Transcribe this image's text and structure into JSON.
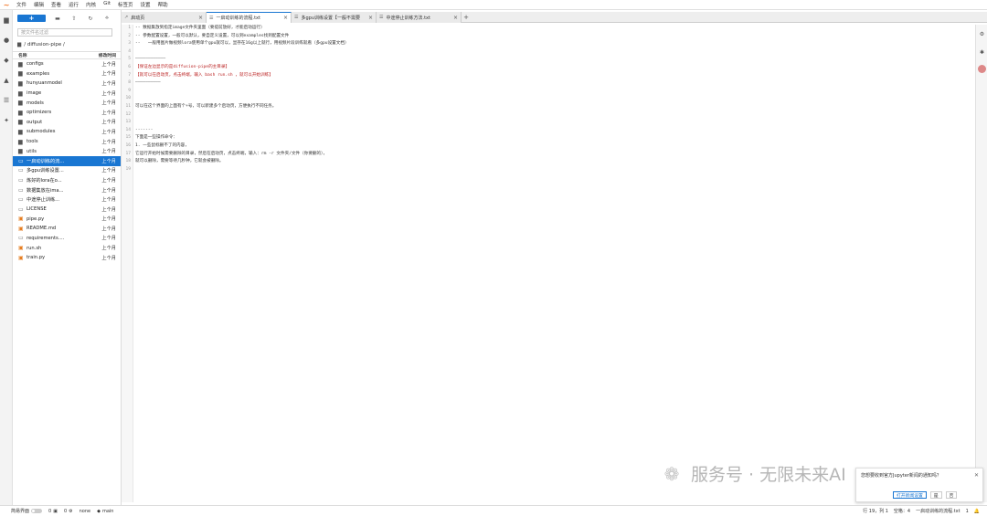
{
  "menu": [
    "文件",
    "编辑",
    "查看",
    "运行",
    "内核",
    "Git",
    "标签页",
    "设置",
    "帮助"
  ],
  "filebrowser": {
    "new_label": "+",
    "filter_placeholder": "按文件名过滤",
    "breadcrumb": "/ diffusion-pipe /",
    "header_name": "名称",
    "header_modified": "修改时间",
    "files": [
      {
        "name": "configs",
        "date": "上个月",
        "type": "folder"
      },
      {
        "name": "examples",
        "date": "上个月",
        "type": "folder"
      },
      {
        "name": "hunyuanmodel",
        "date": "上个月",
        "type": "folder"
      },
      {
        "name": "image",
        "date": "上个月",
        "type": "folder"
      },
      {
        "name": "models",
        "date": "上个月",
        "type": "folder"
      },
      {
        "name": "optimizers",
        "date": "上个月",
        "type": "folder"
      },
      {
        "name": "output",
        "date": "上个月",
        "type": "folder"
      },
      {
        "name": "submodules",
        "date": "上个月",
        "type": "folder"
      },
      {
        "name": "tools",
        "date": "上个月",
        "type": "folder"
      },
      {
        "name": "utils",
        "date": "上个月",
        "type": "folder"
      },
      {
        "name": "一启动训练的流...",
        "date": "上个月",
        "type": "doc",
        "selected": true
      },
      {
        "name": "多gpu训练设置...",
        "date": "上个月",
        "type": "doc"
      },
      {
        "name": "炼好的lora在o...",
        "date": "上个月",
        "type": "doc"
      },
      {
        "name": "数据集放在ima...",
        "date": "上个月",
        "type": "doc"
      },
      {
        "name": "中途停止训练...",
        "date": "上个月",
        "type": "doc"
      },
      {
        "name": "LICENSE",
        "date": "上个月",
        "type": "doc"
      },
      {
        "name": "pipe.py",
        "date": "上个月",
        "type": "py"
      },
      {
        "name": "README.md",
        "date": "上个月",
        "type": "md"
      },
      {
        "name": "requirements....",
        "date": "上个月",
        "type": "doc"
      },
      {
        "name": "run.sh",
        "date": "上个月",
        "type": "py"
      },
      {
        "name": "train.py",
        "date": "上个月",
        "type": "py"
      }
    ]
  },
  "tabs": [
    {
      "label": "启动页",
      "active": false
    },
    {
      "label": "一启动训练的流程.txt",
      "active": true
    },
    {
      "label": "多gpu训练设置【一般不需要",
      "active": false
    },
    {
      "label": "中途停止训练方法.txt",
      "active": false
    }
  ],
  "editor": {
    "lines": [
      "-- 数据集放到指定image文件夹里面（要提前放好，才能启动运行）",
      "-- 参数配置设置，一般可以默认，要自定义设置，可以到examples找到配置文件",
      "--   一般用图片做视频lora使用单个gpu就可以，显存在16g以上就行，用视频片段训练就看（多gpu设置文档）",
      "",
      "————————————",
      "【保证左边显示的是diffusion-pipe的主目录】",
      "【就可以在启动页，点击终端，输入 bash run.sh ，就可以开始训练】",
      "——————————",
      "",
      "",
      "可以在这个界面的上面有个+号，可以新建多个启动页，方便执行不同任务。",
      "",
      "",
      "-------",
      "下面是一些操作命令：",
      "1. 一些鼠标删不了的内容，",
      "它运行开始时候需要删除的目录，然后在启动页，点击终端，输入：rm -r 文件夹/文件（你要删的），",
      "就可以删除，需要等待几秒钟，它就会被删除。",
      ""
    ]
  },
  "status": {
    "simple_mode": "简易界面",
    "count1": "0",
    "count2": "0",
    "kernel": "none",
    "branch": "main",
    "cursor": "行 19，列 1",
    "spaces": "空格：4",
    "filename": "一启动训练的流程.txt",
    "right_num": "1"
  },
  "watermark": "服务号 · 无限未来AI",
  "notification": {
    "message": "您想要收到官方Jupyter新闻的通知吗？",
    "open_label": "打开新闻设置",
    "yes_label": "是",
    "no_label": "否"
  }
}
